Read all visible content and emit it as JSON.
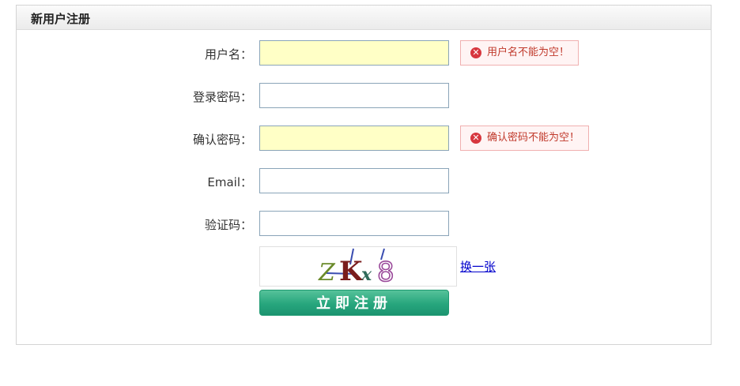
{
  "panel": {
    "title": "新用户注册"
  },
  "form": {
    "username": {
      "label": "用户名：",
      "value": "",
      "error": "用户名不能为空！"
    },
    "password": {
      "label": "登录密码：",
      "value": ""
    },
    "confirm_password": {
      "label": "确认密码：",
      "value": "",
      "error": "确认密码不能为空！"
    },
    "email": {
      "label": "Email：",
      "value": ""
    },
    "captcha_input": {
      "label": "验证码：",
      "value": ""
    },
    "captcha_image": {
      "text": "ZKx8"
    },
    "refresh_link": "换一张",
    "submit_label": "立即注册"
  },
  "icons": {
    "error": "error-circle-x-icon"
  },
  "colors": {
    "invalid_input_bg": "#ffffc6",
    "error_text": "#c0392b",
    "error_bg": "#fff4f4",
    "submit_green": "#27a67d",
    "link": "#0000cc"
  }
}
